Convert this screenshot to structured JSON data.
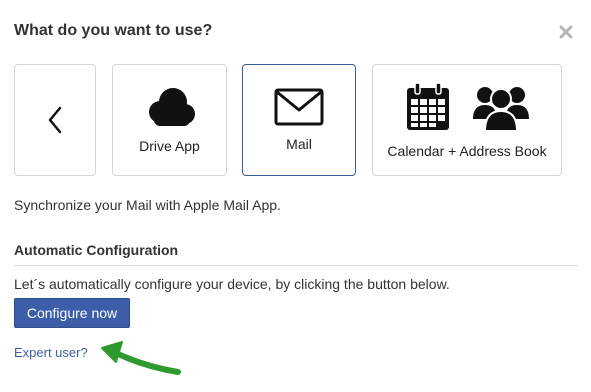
{
  "dialog": {
    "title": "What do you want to use?",
    "close_icon": "close-icon"
  },
  "tiles": [
    {
      "name": "back",
      "label": "",
      "icon": "chevron-left-icon",
      "selected": false
    },
    {
      "name": "drive",
      "label": "Drive App",
      "icon": "cloud-icon",
      "selected": false
    },
    {
      "name": "mail",
      "label": "Mail",
      "icon": "envelope-icon",
      "selected": true
    },
    {
      "name": "calendar-address",
      "label": "Calendar + Address Book",
      "icons": [
        "calendar-icon",
        "users-icon"
      ],
      "selected": false
    }
  ],
  "description": "Synchronize your Mail with Apple Mail App.",
  "section": {
    "title": "Automatic Configuration",
    "instruction": "Let´s automatically configure your device, by clicking the button below.",
    "button_label": "Configure now",
    "expert_link": "Expert user?"
  },
  "colors": {
    "accent": "#3c5ea8",
    "selected_border": "#3a5a99",
    "link": "#3a5ea6",
    "arrow": "#2e9a2e"
  }
}
